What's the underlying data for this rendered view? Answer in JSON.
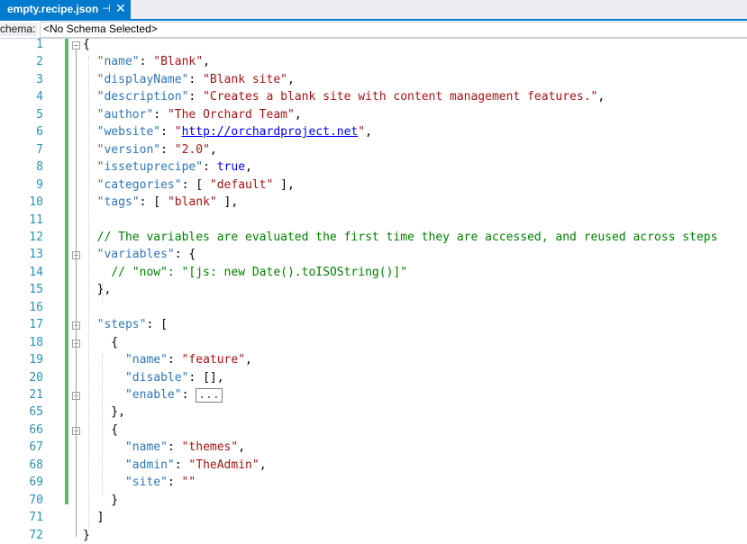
{
  "tab": {
    "title": "empty.recipe.json",
    "pin": "⊣",
    "close": "✕"
  },
  "schema": {
    "label": "chema:",
    "value": "<No Schema Selected>"
  },
  "lines": [
    {
      "n": "1",
      "t": [
        [
          "p",
          "{"
        ]
      ]
    },
    {
      "n": "2",
      "t": [
        [
          "p",
          "  "
        ],
        [
          "k",
          "\"name\""
        ],
        [
          "p",
          ": "
        ],
        [
          "s",
          "\"Blank\""
        ],
        [
          "p",
          ","
        ]
      ]
    },
    {
      "n": "3",
      "t": [
        [
          "p",
          "  "
        ],
        [
          "k",
          "\"displayName\""
        ],
        [
          "p",
          ": "
        ],
        [
          "s",
          "\"Blank site\""
        ],
        [
          "p",
          ","
        ]
      ]
    },
    {
      "n": "4",
      "t": [
        [
          "p",
          "  "
        ],
        [
          "k",
          "\"description\""
        ],
        [
          "p",
          ": "
        ],
        [
          "s",
          "\"Creates a blank site with content management features.\""
        ],
        [
          "p",
          ","
        ]
      ]
    },
    {
      "n": "5",
      "t": [
        [
          "p",
          "  "
        ],
        [
          "k",
          "\"author\""
        ],
        [
          "p",
          ": "
        ],
        [
          "s",
          "\"The Orchard Team\""
        ],
        [
          "p",
          ","
        ]
      ]
    },
    {
      "n": "6",
      "t": [
        [
          "p",
          "  "
        ],
        [
          "k",
          "\"website\""
        ],
        [
          "p",
          ": "
        ],
        [
          "s",
          "\""
        ],
        [
          "url",
          "http://orchardproject.net"
        ],
        [
          "s",
          "\""
        ],
        [
          "p",
          ","
        ]
      ]
    },
    {
      "n": "7",
      "t": [
        [
          "p",
          "  "
        ],
        [
          "k",
          "\"version\""
        ],
        [
          "p",
          ": "
        ],
        [
          "s",
          "\"2.0\""
        ],
        [
          "p",
          ","
        ]
      ]
    },
    {
      "n": "8",
      "t": [
        [
          "p",
          "  "
        ],
        [
          "k",
          "\"issetuprecipe\""
        ],
        [
          "p",
          ": "
        ],
        [
          "kw",
          "true"
        ],
        [
          "p",
          ","
        ]
      ]
    },
    {
      "n": "9",
      "t": [
        [
          "p",
          "  "
        ],
        [
          "k",
          "\"categories\""
        ],
        [
          "p",
          ": [ "
        ],
        [
          "s",
          "\"default\""
        ],
        [
          "p",
          " ],"
        ]
      ]
    },
    {
      "n": "10",
      "t": [
        [
          "p",
          "  "
        ],
        [
          "k",
          "\"tags\""
        ],
        [
          "p",
          ": [ "
        ],
        [
          "s",
          "\"blank\""
        ],
        [
          "p",
          " ],"
        ]
      ]
    },
    {
      "n": "11",
      "t": []
    },
    {
      "n": "12",
      "t": [
        [
          "p",
          "  "
        ],
        [
          "c",
          "// The variables are evaluated the first time they are accessed, and reused across steps"
        ]
      ]
    },
    {
      "n": "13",
      "t": [
        [
          "p",
          "  "
        ],
        [
          "k",
          "\"variables\""
        ],
        [
          "p",
          ": {"
        ]
      ]
    },
    {
      "n": "14",
      "t": [
        [
          "p",
          "    "
        ],
        [
          "c",
          "// \"now\": \"[js: new Date().toISOString()]\""
        ]
      ]
    },
    {
      "n": "15",
      "t": [
        [
          "p",
          "  },"
        ]
      ]
    },
    {
      "n": "16",
      "t": []
    },
    {
      "n": "17",
      "t": [
        [
          "p",
          "  "
        ],
        [
          "k",
          "\"steps\""
        ],
        [
          "p",
          ": ["
        ]
      ]
    },
    {
      "n": "18",
      "t": [
        [
          "p",
          "    {"
        ]
      ]
    },
    {
      "n": "19",
      "t": [
        [
          "p",
          "      "
        ],
        [
          "k",
          "\"name\""
        ],
        [
          "p",
          ": "
        ],
        [
          "s",
          "\"feature\""
        ],
        [
          "p",
          ","
        ]
      ]
    },
    {
      "n": "20",
      "t": [
        [
          "p",
          "      "
        ],
        [
          "k",
          "\"disable\""
        ],
        [
          "p",
          ": [],"
        ]
      ]
    },
    {
      "n": "21",
      "t": [
        [
          "p",
          "      "
        ],
        [
          "k",
          "\"enable\""
        ],
        [
          "p",
          ": "
        ],
        [
          "e",
          "..."
        ]
      ]
    },
    {
      "n": "65",
      "t": [
        [
          "p",
          "    },"
        ]
      ]
    },
    {
      "n": "66",
      "t": [
        [
          "p",
          "    {"
        ]
      ]
    },
    {
      "n": "67",
      "t": [
        [
          "p",
          "      "
        ],
        [
          "k",
          "\"name\""
        ],
        [
          "p",
          ": "
        ],
        [
          "s",
          "\"themes\""
        ],
        [
          "p",
          ","
        ]
      ]
    },
    {
      "n": "68",
      "t": [
        [
          "p",
          "      "
        ],
        [
          "k",
          "\"admin\""
        ],
        [
          "p",
          ": "
        ],
        [
          "s",
          "\"TheAdmin\""
        ],
        [
          "p",
          ","
        ]
      ]
    },
    {
      "n": "69",
      "t": [
        [
          "p",
          "      "
        ],
        [
          "k",
          "\"site\""
        ],
        [
          "p",
          ": "
        ],
        [
          "s",
          "\"\""
        ]
      ]
    },
    {
      "n": "70",
      "t": [
        [
          "p",
          "    }"
        ]
      ]
    },
    {
      "n": "71",
      "t": [
        [
          "p",
          "  ]"
        ]
      ]
    },
    {
      "n": "72",
      "t": [
        [
          "p",
          "}"
        ]
      ]
    }
  ],
  "folds": {
    "minus": "−",
    "plus": "+"
  }
}
